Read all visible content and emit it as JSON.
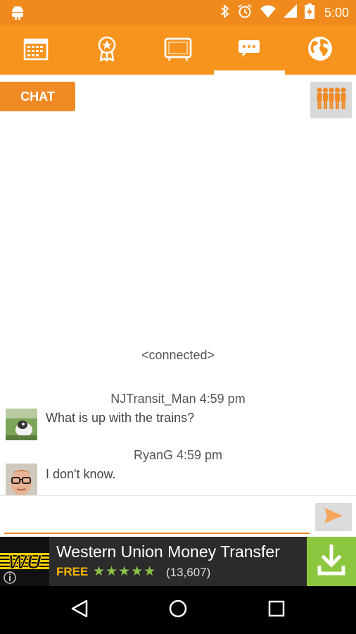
{
  "status_bar": {
    "time": "5:00"
  },
  "tabs": [
    {
      "name": "calendar-icon",
      "active": false
    },
    {
      "name": "award-icon",
      "active": false
    },
    {
      "name": "tv-icon",
      "active": false
    },
    {
      "name": "chat-bubble-icon",
      "active": true
    },
    {
      "name": "globe-icon",
      "active": false
    }
  ],
  "chat": {
    "tab_label": "CHAT",
    "connected_text": "<connected>",
    "messages": [
      {
        "header": "NJTransit_Man 4:59 pm",
        "text": "What is up with the trains?"
      },
      {
        "header": "RyanG 4:59 pm",
        "text": "I don't know."
      }
    ]
  },
  "input": {
    "value": "",
    "placeholder": ""
  },
  "ad": {
    "logo_text": "WU",
    "title": "Western Union Money Transfer",
    "price": "FREE",
    "rating": 4.5,
    "stars": "★★★★★",
    "review_count": "(13,607)"
  },
  "colors": {
    "accent": "#f7941d",
    "status_bar": "#f08a1c",
    "download": "#8dc63f"
  }
}
